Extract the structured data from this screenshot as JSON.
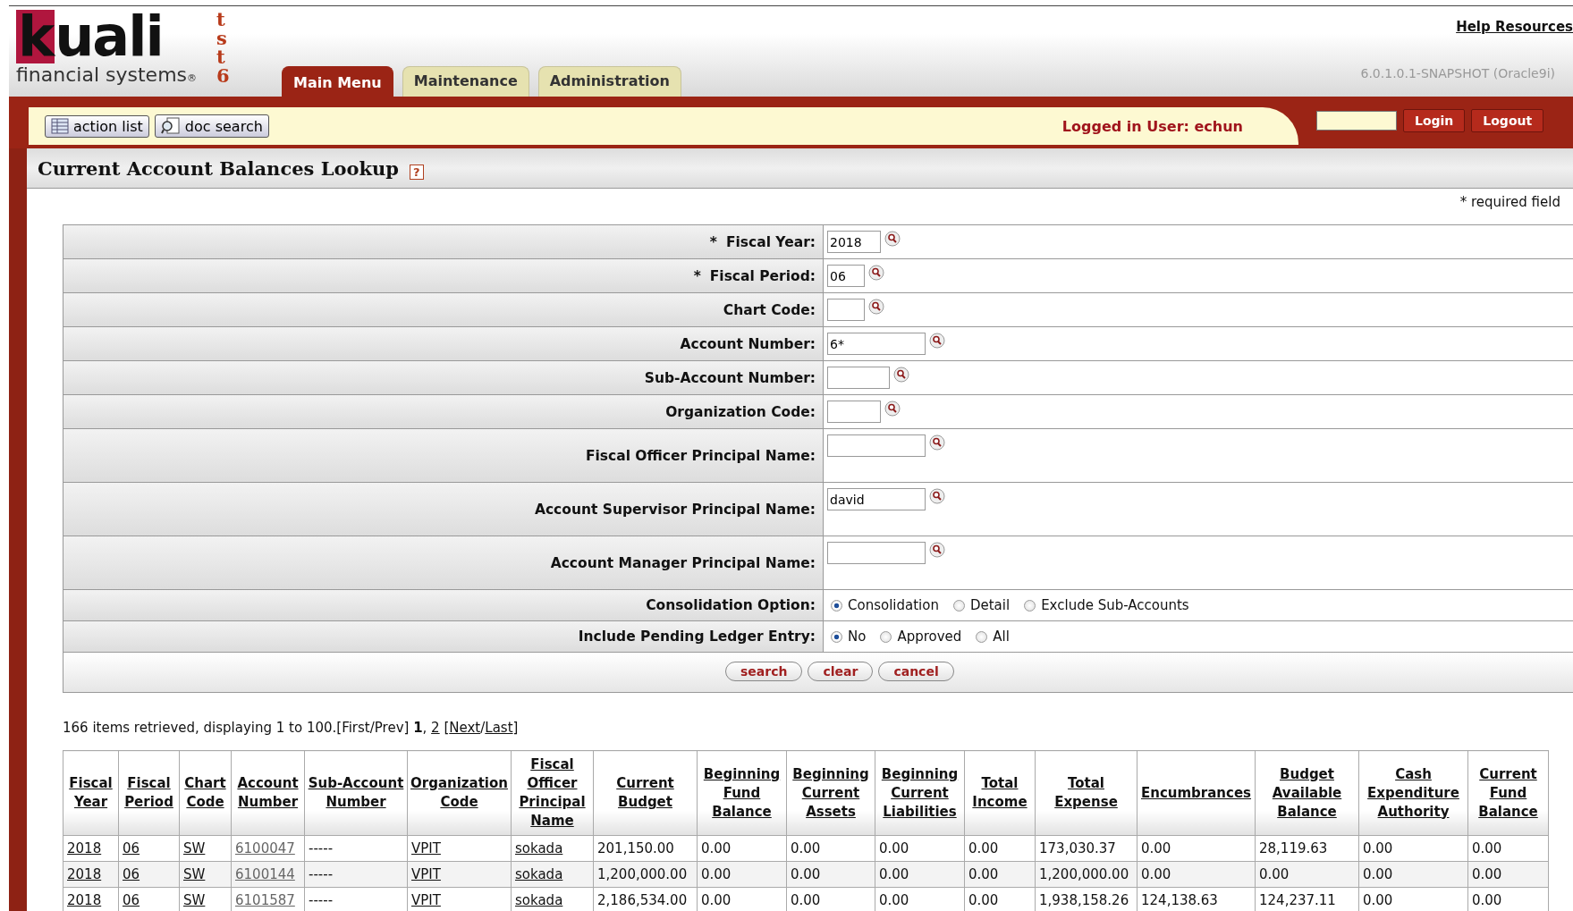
{
  "header": {
    "logo": {
      "word": "kuali",
      "tagline": "financial systems",
      "mark": "®",
      "env": "tst6"
    },
    "tabs": [
      {
        "label": "Main Menu",
        "selected": true
      },
      {
        "label": "Maintenance",
        "selected": false
      },
      {
        "label": "Administration",
        "selected": false
      }
    ],
    "help_link": "Help Resources",
    "version": "6.0.1.0.1-SNAPSHOT (Oracle9i)"
  },
  "toolbar": {
    "buttons": [
      "action list",
      "doc search"
    ],
    "logged_in": "Logged in User: echun",
    "login_button": "Login",
    "logout_button": "Logout"
  },
  "page": {
    "title": "Current Account Balances Lookup",
    "help_icon": "?",
    "required_note": "* required field"
  },
  "form": {
    "fields": [
      {
        "required_mark": "*",
        "label": "Fiscal Year:",
        "value": "2018"
      },
      {
        "required_mark": "*",
        "label": "Fiscal Period:",
        "value": "06"
      },
      {
        "label": "Chart Code:"
      },
      {
        "label": "Account Number:",
        "value": "6*"
      },
      {
        "label": "Sub-Account Number:"
      },
      {
        "label": "Organization Code:"
      },
      {
        "label": "Fiscal Officer Principal Name:"
      },
      {
        "label": "Account Supervisor Principal Name:",
        "value": "david"
      },
      {
        "label": "Account Manager Principal Name:"
      }
    ],
    "radio_groups": [
      {
        "label": "Consolidation Option:",
        "options": [
          {
            "label": "Consolidation",
            "selected": true
          },
          {
            "label": "Detail",
            "selected": false
          },
          {
            "label": "Exclude Sub-Accounts",
            "selected": false
          }
        ]
      },
      {
        "label": "Include Pending Ledger Entry:",
        "options": [
          {
            "label": "No",
            "selected": true
          },
          {
            "label": "Approved",
            "selected": false
          },
          {
            "label": "All",
            "selected": false
          }
        ]
      }
    ],
    "buttons": [
      "search",
      "clear",
      "cancel"
    ]
  },
  "results": {
    "summary": "166 items retrieved, displaying 1 to 100.[First/Prev] ",
    "current_page": "1",
    "separator": ", ",
    "next_page": "2",
    "nav_open": " [",
    "next": "Next",
    "slash": "/",
    "last": "Last",
    "nav_close": "]",
    "columns": [
      {
        "label": "Fiscal Year",
        "kind": "link"
      },
      {
        "label": "Fiscal Period",
        "kind": "link"
      },
      {
        "label": "Chart Code",
        "kind": "link"
      },
      {
        "label": "Account Number",
        "kind": "link"
      },
      {
        "label": "Sub-Account Number",
        "kind": "text"
      },
      {
        "label": "Organization Code",
        "kind": "link"
      },
      {
        "label": "Fiscal Officer Principal Name",
        "kind": "link"
      },
      {
        "label": "Current Budget",
        "kind": "text"
      },
      {
        "label": "Beginning Fund Balance",
        "kind": "text"
      },
      {
        "label": "Beginning Current Assets",
        "kind": "text"
      },
      {
        "label": "Beginning Current Liabilities",
        "kind": "text"
      },
      {
        "label": "Total Income",
        "kind": "text"
      },
      {
        "label": "Total Expense",
        "kind": "text"
      },
      {
        "label": "Encumbrances",
        "kind": "text"
      },
      {
        "label": "Budget Available Balance",
        "kind": "text"
      },
      {
        "label": "Cash Expenditure Authority",
        "kind": "text"
      },
      {
        "label": "Current Fund Balance",
        "kind": "text"
      }
    ],
    "rows": [
      [
        "2018",
        "06",
        "SW",
        "6100047",
        "-----",
        "VPIT",
        "sokada",
        "201,150.00",
        "0.00",
        "0.00",
        "0.00",
        "0.00",
        "173,030.37",
        "0.00",
        "28,119.63",
        "0.00",
        "0.00"
      ],
      [
        "2018",
        "06",
        "SW",
        "6100144",
        "-----",
        "VPIT",
        "sokada",
        "1,200,000.00",
        "0.00",
        "0.00",
        "0.00",
        "0.00",
        "1,200,000.00",
        "0.00",
        "0.00",
        "0.00",
        "0.00"
      ],
      [
        "2018",
        "06",
        "SW",
        "6101587",
        "-----",
        "VPIT",
        "sokada",
        "2,186,534.00",
        "0.00",
        "0.00",
        "0.00",
        "0.00",
        "1,938,158.26",
        "124,138.63",
        "124,237.11",
        "0.00",
        "0.00"
      ]
    ]
  }
}
